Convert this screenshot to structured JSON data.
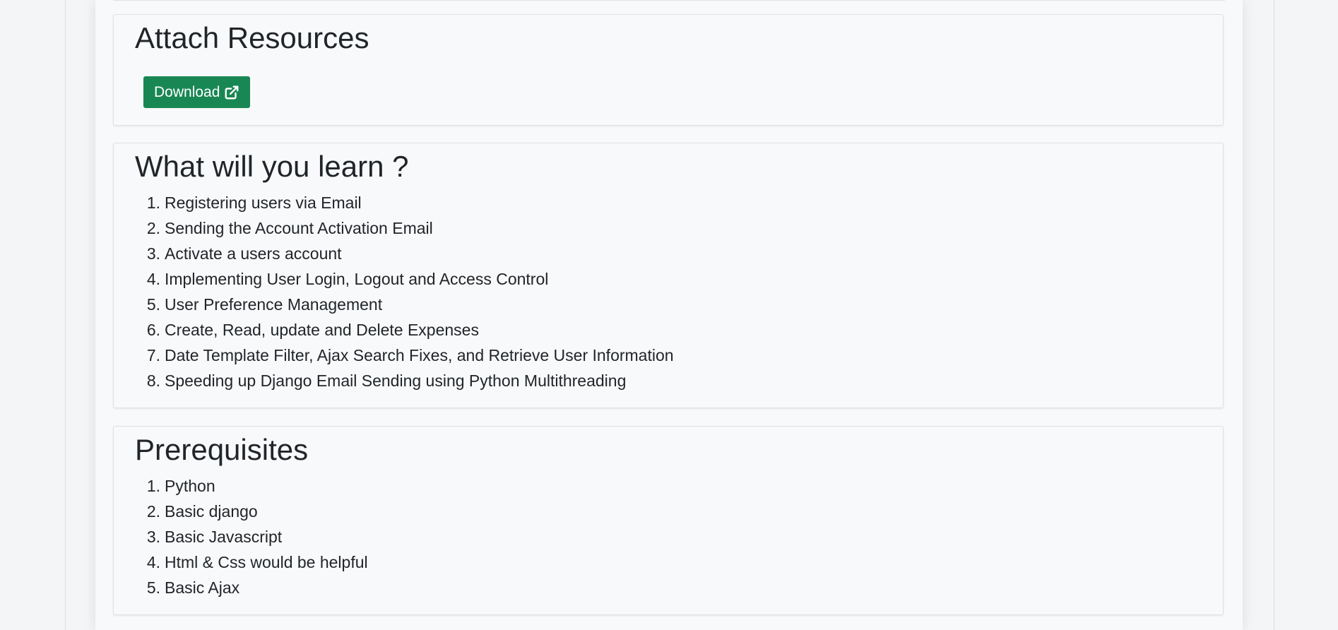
{
  "resources": {
    "title": "Attach Resources",
    "download_label": "Download",
    "download_icon": "external-link-icon",
    "button_color": "#198754"
  },
  "learn": {
    "title": "What will you learn ?",
    "items": [
      "Registering users via Email",
      "Sending the Account Activation Email",
      "Activate a users account",
      "Implementing User Login, Logout and Access Control",
      "User Preference Management",
      "Create, Read, update and Delete Expenses",
      "Date Template Filter, Ajax Search Fixes, and Retrieve User Information",
      "Speeding up Django Email Sending using Python Multithreading"
    ]
  },
  "prereq": {
    "title": "Prerequisites",
    "items": [
      "Python",
      "Basic django",
      "Basic Javascript",
      "Html & Css would be helpful",
      "Basic Ajax"
    ]
  }
}
